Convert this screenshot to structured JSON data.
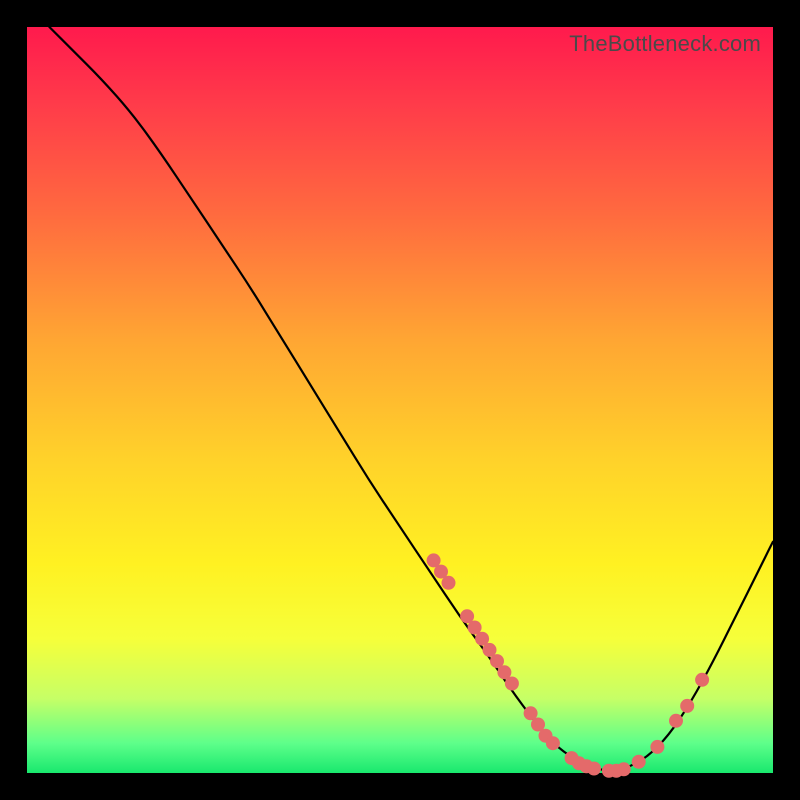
{
  "watermark": "TheBottleneck.com",
  "colors": {
    "gradient_top": "#ff1a4d",
    "gradient_bottom": "#19e86e",
    "curve": "#000000",
    "dots": "#e46a6a",
    "frame": "#000000"
  },
  "chart_data": {
    "type": "line",
    "title": "",
    "xlabel": "",
    "ylabel": "",
    "xlim": [
      0,
      100
    ],
    "ylim": [
      0,
      100
    ],
    "series": [
      {
        "name": "bottleneck-curve",
        "x": [
          3,
          6,
          10,
          14,
          18,
          22,
          26,
          30,
          34,
          38,
          42,
          46,
          50,
          54,
          58,
          62,
          65,
          68,
          70,
          72,
          74,
          76,
          78,
          80,
          83,
          86,
          89,
          92,
          95,
          98,
          100
        ],
        "y": [
          100,
          97,
          93,
          88.5,
          83,
          77,
          71,
          65,
          58.5,
          52,
          45.5,
          39,
          33,
          27,
          21,
          15.5,
          11,
          7,
          4.5,
          2.8,
          1.5,
          0.7,
          0.2,
          0.5,
          2,
          5,
          9.5,
          15,
          21,
          27,
          31
        ]
      }
    ],
    "points": [
      {
        "x": 54.5,
        "y": 28.5
      },
      {
        "x": 55.5,
        "y": 27
      },
      {
        "x": 56.5,
        "y": 25.5
      },
      {
        "x": 59,
        "y": 21
      },
      {
        "x": 60,
        "y": 19.5
      },
      {
        "x": 61,
        "y": 18
      },
      {
        "x": 62,
        "y": 16.5
      },
      {
        "x": 63,
        "y": 15
      },
      {
        "x": 64,
        "y": 13.5
      },
      {
        "x": 65,
        "y": 12
      },
      {
        "x": 67.5,
        "y": 8
      },
      {
        "x": 68.5,
        "y": 6.5
      },
      {
        "x": 69.5,
        "y": 5
      },
      {
        "x": 70.5,
        "y": 4
      },
      {
        "x": 73,
        "y": 2
      },
      {
        "x": 74,
        "y": 1.3
      },
      {
        "x": 75,
        "y": 0.9
      },
      {
        "x": 76,
        "y": 0.6
      },
      {
        "x": 78,
        "y": 0.3
      },
      {
        "x": 79,
        "y": 0.3
      },
      {
        "x": 80,
        "y": 0.5
      },
      {
        "x": 82,
        "y": 1.5
      },
      {
        "x": 84.5,
        "y": 3.5
      },
      {
        "x": 87,
        "y": 7
      },
      {
        "x": 88.5,
        "y": 9
      },
      {
        "x": 90.5,
        "y": 12.5
      }
    ]
  }
}
